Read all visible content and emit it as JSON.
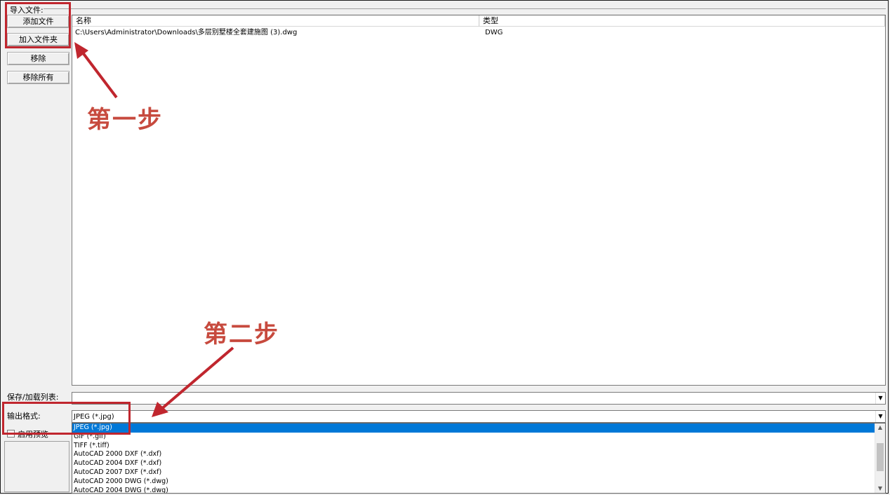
{
  "import_group": {
    "label": "导入文件:"
  },
  "buttons": {
    "add_file": "添加文件",
    "add_folder": "加入文件夹",
    "remove": "移除",
    "remove_all": "移除所有"
  },
  "file_list": {
    "columns": [
      "名称",
      "类型"
    ],
    "rows": [
      {
        "name": "C:\\Users\\Administrator\\Downloads\\多层别墅楼全套建施图 (3).dwg",
        "type": "DWG"
      }
    ]
  },
  "save_load_list": {
    "label": "保存/加载列表:",
    "value": ""
  },
  "output_format": {
    "label": "输出格式:",
    "value": "JPEG (*.jpg)",
    "options": [
      "JPEG (*.jpg)",
      "GIF (*.gif)",
      "TIFF (*.tiff)",
      "AutoCAD 2000 DXF (*.dxf)",
      "AutoCAD 2004 DXF (*.dxf)",
      "AutoCAD 2007 DXF (*.dxf)",
      "AutoCAD 2000 DWG (*.dwg)",
      "AutoCAD 2004 DWG (*.dwg)"
    ],
    "selected_index": 0
  },
  "preview_checkbox": {
    "label": "启用预览"
  },
  "annotations": {
    "step1": "第一步",
    "step2": "第二步",
    "color": "#c0262e"
  },
  "icons": {
    "dropdown_arrow": "chevron-down-icon",
    "scroll_up": "chevron-up-icon",
    "scroll_down": "chevron-down-icon"
  }
}
